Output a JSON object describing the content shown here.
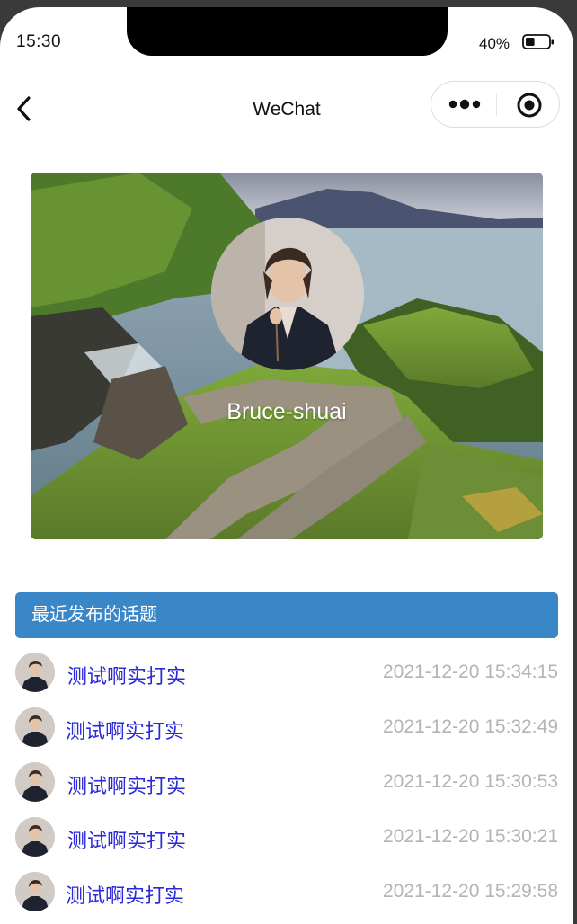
{
  "status_bar": {
    "time": "15:30",
    "battery_text": "40%",
    "battery_level": 0.4
  },
  "navbar": {
    "title": "WeChat",
    "icons": [
      "back-chevron-icon",
      "more-dots-icon",
      "close-target-icon"
    ]
  },
  "banner": {
    "username": "Bruce-shuai"
  },
  "section": {
    "title": "最近发布的话题"
  },
  "topics": [
    {
      "title": "测试啊实打实",
      "time": "2021-12-20 15:34:15"
    },
    {
      "title": "测试啊实打实",
      "time": "2021-12-20 15:32:49"
    },
    {
      "title": "测试啊实打实",
      "time": "2021-12-20 15:30:53"
    },
    {
      "title": "测试啊实打实",
      "time": "2021-12-20 15:30:21"
    },
    {
      "title": "测试啊实打实",
      "time": "2021-12-20 15:29:58"
    }
  ],
  "colors": {
    "section_header": "#3a87c8",
    "topic_title": "#2a2ad8",
    "topic_time": "#b4b4b4"
  }
}
